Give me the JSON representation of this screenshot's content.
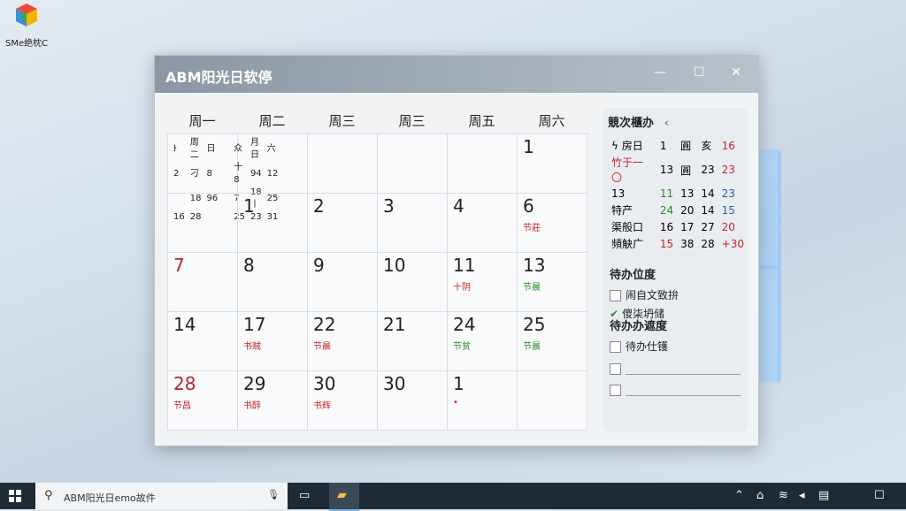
{
  "desktop": {
    "icon_label": "SMe绝枕C"
  },
  "window": {
    "title": "ABM阳光日软停",
    "minimize": "—",
    "maximize": "☐",
    "close": "✕"
  },
  "calendar": {
    "weekdays": [
      "周一",
      "周二",
      "周三",
      "周三",
      "周五",
      "周六"
    ],
    "mini": {
      "rows": [
        [
          "ŀ",
          "周二",
          "日",
          "",
          "众",
          "月日",
          "六"
        ],
        [
          "2",
          "刁",
          "8",
          "",
          "十8",
          "94",
          "12"
        ],
        [
          "",
          "18",
          "96",
          "",
          "7",
          "18丨",
          "25"
        ],
        [
          "16",
          "28",
          "",
          "",
          "25",
          "23",
          "31"
        ]
      ]
    },
    "cells": [
      {
        "n": "",
        "s": ""
      },
      {
        "n": "",
        "s": ""
      },
      {
        "n": "",
        "s": ""
      },
      {
        "n": "",
        "s": ""
      },
      {
        "n": "",
        "s": ""
      },
      {
        "n": "1",
        "s": ""
      },
      {
        "n": "",
        "s": ""
      },
      {
        "n": "1",
        "s": ""
      },
      {
        "n": "2",
        "s": ""
      },
      {
        "n": "3",
        "s": ""
      },
      {
        "n": "4",
        "s": ""
      },
      {
        "n": "6",
        "s": "节莊"
      },
      {
        "n": "7",
        "s": ""
      },
      {
        "n": "8",
        "s": ""
      },
      {
        "n": "9",
        "s": ""
      },
      {
        "n": "10",
        "s": ""
      },
      {
        "n": "11",
        "s": "十阴"
      },
      {
        "n": "13",
        "s": "节晨"
      },
      {
        "n": "14",
        "s": ""
      },
      {
        "n": "17",
        "s": "书贼"
      },
      {
        "n": "22",
        "s": "节晨"
      },
      {
        "n": "21",
        "s": ""
      },
      {
        "n": "24",
        "s": "节贫"
      },
      {
        "n": "25",
        "s": "节晨"
      },
      {
        "n": "28",
        "s": "节昌"
      },
      {
        "n": "29",
        "s": "书醉"
      },
      {
        "n": "30",
        "s": "书辉"
      },
      {
        "n": "30",
        "s": ""
      },
      {
        "n": "1",
        "s": "•"
      },
      {
        "n": "",
        "s": ""
      }
    ]
  },
  "stats": {
    "title": "競次櫃办",
    "arrow": "‹",
    "rows": [
      [
        "ϟ 房日",
        "1",
        "圓",
        "亥",
        "16"
      ],
      [
        "竹于一〇",
        "13",
        "圓",
        "23",
        "23"
      ],
      [
        "13",
        "11",
        "13",
        "14",
        "23"
      ],
      [
        "特产",
        "24",
        "20",
        "14",
        "15"
      ],
      [
        "渠般口",
        "16",
        "17",
        "27",
        "20"
      ],
      [
        "頻觖广",
        "15",
        "38",
        "28",
        "+30"
      ]
    ]
  },
  "todos": {
    "section1": "待办位度",
    "items1": [
      "闹自文致拚",
      "傻柒坍储"
    ],
    "section2": "待办办遮度",
    "items2": [
      "待办仕镬",
      "",
      ""
    ]
  },
  "taskbar": {
    "search_text": "ABM阳光日emo故件"
  },
  "colors": {
    "accent": "#8c97a3",
    "red": "#c0262b",
    "green": "#2c8a2c",
    "blue": "#1f5fa8"
  }
}
